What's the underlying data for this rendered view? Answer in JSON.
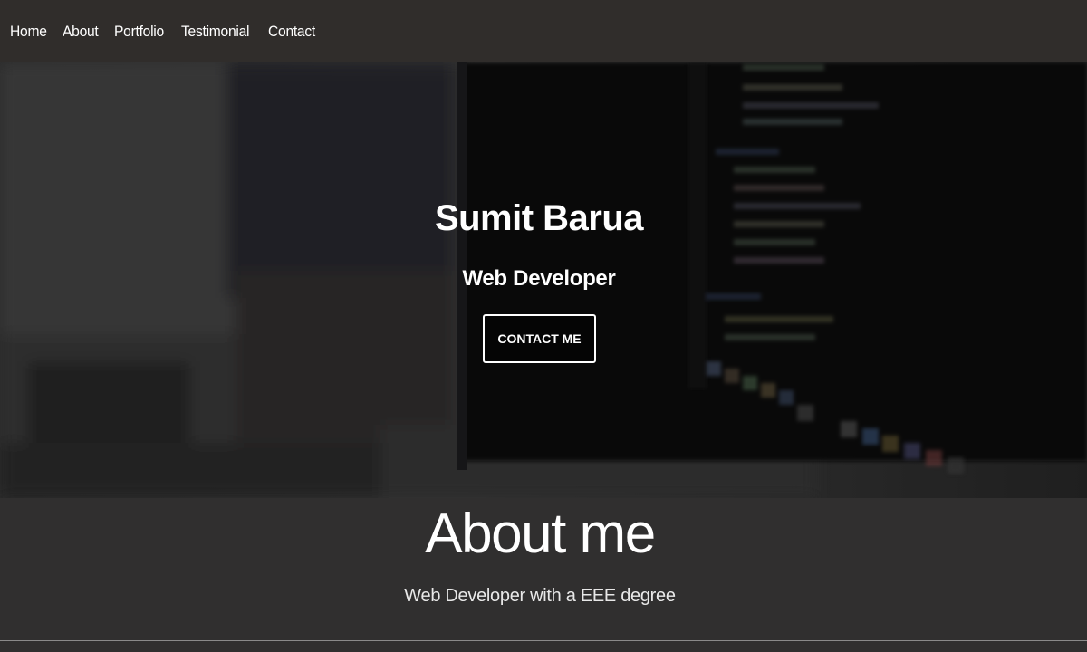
{
  "nav": {
    "items": [
      {
        "label": "Home"
      },
      {
        "label": "About"
      },
      {
        "label": "Portfolio"
      },
      {
        "label": "Testimonial"
      },
      {
        "label": "Contact"
      }
    ]
  },
  "hero": {
    "name": "Sumit Barua",
    "role": "Web Developer",
    "button_label": "CONTACT ME"
  },
  "about": {
    "title": "About me",
    "text": "Web Developer with a EEE degree"
  },
  "colors": {
    "nav_bg": "#302d2b",
    "page_bg": "#302f2f",
    "text": "#ffffff"
  }
}
